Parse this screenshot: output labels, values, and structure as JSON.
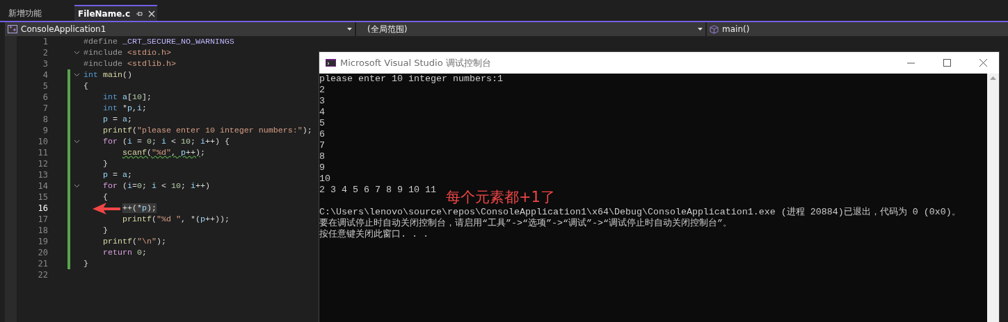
{
  "tabs": [
    {
      "label": "新增功能",
      "selected": false
    },
    {
      "label": "FileName.c",
      "selected": true
    }
  ],
  "nav_bar": {
    "project": "ConsoleApplication1",
    "scope": "(全局范围)",
    "member": "main()"
  },
  "editor": {
    "lines": [
      {
        "number": "1",
        "tokens": [
          {
            "t": "#define ",
            "kind": "pre"
          },
          {
            "t": "_CRT_SECURE_NO_WARNINGS",
            "kind": "macro"
          }
        ]
      },
      {
        "number": "2",
        "expanded": true,
        "tokens": [
          {
            "t": "#include ",
            "kind": "pre"
          },
          {
            "t": "<stdio.h>",
            "kind": "str"
          }
        ]
      },
      {
        "number": "3",
        "tokens": [
          {
            "t": "#include ",
            "kind": "pre"
          },
          {
            "t": "<stdlib.h>",
            "kind": "str"
          }
        ]
      },
      {
        "number": "4",
        "expanded": true,
        "changed": true,
        "tokens": [
          {
            "t": "int ",
            "kind": "kw"
          },
          {
            "t": "main",
            "kind": "fn"
          },
          {
            "t": "()",
            "kind": "p"
          }
        ]
      },
      {
        "number": "5",
        "changed": true,
        "tokens": [
          {
            "t": "{",
            "kind": "p"
          }
        ]
      },
      {
        "number": "6",
        "changed": true,
        "tokens": [
          {
            "t": "    int ",
            "kind": "kw"
          },
          {
            "t": "a",
            "kind": "var"
          },
          {
            "t": "[",
            "kind": "p"
          },
          {
            "t": "10",
            "kind": "num"
          },
          {
            "t": "];",
            "kind": "p"
          }
        ]
      },
      {
        "number": "7",
        "changed": true,
        "tokens": [
          {
            "t": "    int ",
            "kind": "kw"
          },
          {
            "t": "*",
            "kind": "p"
          },
          {
            "t": "p",
            "kind": "var"
          },
          {
            "t": ",",
            "kind": "p"
          },
          {
            "t": "i",
            "kind": "var"
          },
          {
            "t": ";",
            "kind": "p"
          }
        ]
      },
      {
        "number": "8",
        "changed": true,
        "tokens": [
          {
            "t": "    p",
            "kind": "var"
          },
          {
            "t": " = ",
            "kind": "p"
          },
          {
            "t": "a",
            "kind": "var"
          },
          {
            "t": ";",
            "kind": "p"
          }
        ]
      },
      {
        "number": "9",
        "changed": true,
        "tokens": [
          {
            "t": "    printf",
            "kind": "fn"
          },
          {
            "t": "(",
            "kind": "p"
          },
          {
            "t": "\"please enter 10 integer numbers:\"",
            "kind": "str"
          },
          {
            "t": ");",
            "kind": "p"
          }
        ]
      },
      {
        "number": "10",
        "expanded": true,
        "changed": true,
        "tokens": [
          {
            "t": "    for ",
            "kind": "ctl"
          },
          {
            "t": "(",
            "kind": "p"
          },
          {
            "t": "i",
            "kind": "var"
          },
          {
            "t": " = ",
            "kind": "p"
          },
          {
            "t": "0",
            "kind": "num"
          },
          {
            "t": "; ",
            "kind": "p"
          },
          {
            "t": "i",
            "kind": "var"
          },
          {
            "t": " < ",
            "kind": "p"
          },
          {
            "t": "10",
            "kind": "num"
          },
          {
            "t": "; ",
            "kind": "p"
          },
          {
            "t": "i",
            "kind": "var"
          },
          {
            "t": "++) {",
            "kind": "p"
          }
        ]
      },
      {
        "number": "11",
        "changed": true,
        "tokens": [
          {
            "t": "        scanf",
            "kind": "fn",
            "warning": true
          },
          {
            "t": "(",
            "kind": "p",
            "warning": true
          },
          {
            "t": "\"%d\"",
            "kind": "str",
            "warning": true
          },
          {
            "t": ", ",
            "kind": "p",
            "warning": true
          },
          {
            "t": "p",
            "kind": "var",
            "warning": true
          },
          {
            "t": "++)",
            "kind": "p",
            "warning": true
          },
          {
            "t": ";",
            "kind": "p"
          }
        ]
      },
      {
        "number": "12",
        "changed": true,
        "tokens": [
          {
            "t": "    }",
            "kind": "p"
          }
        ]
      },
      {
        "number": "13",
        "changed": true,
        "tokens": [
          {
            "t": "    p",
            "kind": "var"
          },
          {
            "t": " = ",
            "kind": "p"
          },
          {
            "t": "a",
            "kind": "var"
          },
          {
            "t": ";",
            "kind": "p"
          }
        ]
      },
      {
        "number": "14",
        "expanded": true,
        "changed": true,
        "tokens": [
          {
            "t": "    for ",
            "kind": "ctl"
          },
          {
            "t": "(",
            "kind": "p"
          },
          {
            "t": "i",
            "kind": "var"
          },
          {
            "t": "=",
            "kind": "p"
          },
          {
            "t": "0",
            "kind": "num"
          },
          {
            "t": "; ",
            "kind": "p"
          },
          {
            "t": "i",
            "kind": "var"
          },
          {
            "t": " < ",
            "kind": "p"
          },
          {
            "t": "10",
            "kind": "num"
          },
          {
            "t": "; ",
            "kind": "p"
          },
          {
            "t": "i",
            "kind": "var"
          },
          {
            "t": "++)",
            "kind": "p"
          }
        ]
      },
      {
        "number": "15",
        "changed": true,
        "tokens": [
          {
            "t": "    {",
            "kind": "p"
          }
        ]
      },
      {
        "number": "16",
        "changed": true,
        "current": true,
        "tokens": [
          {
            "t": "        ++(*",
            "kind": "p",
            "highlight": true
          },
          {
            "t": "p",
            "kind": "var",
            "highlight": true
          },
          {
            "t": ");",
            "kind": "p",
            "highlight": true
          }
        ]
      },
      {
        "number": "17",
        "changed": true,
        "tokens": [
          {
            "t": "        printf",
            "kind": "fn"
          },
          {
            "t": "(",
            "kind": "p"
          },
          {
            "t": "\"%d \"",
            "kind": "str"
          },
          {
            "t": ", *(",
            "kind": "p"
          },
          {
            "t": "p",
            "kind": "var"
          },
          {
            "t": "++));",
            "kind": "p"
          }
        ]
      },
      {
        "number": "18",
        "changed": true,
        "tokens": [
          {
            "t": "    }",
            "kind": "p"
          }
        ]
      },
      {
        "number": "19",
        "changed": true,
        "tokens": [
          {
            "t": "    printf",
            "kind": "fn"
          },
          {
            "t": "(",
            "kind": "p"
          },
          {
            "t": "\"\\n\"",
            "kind": "str"
          },
          {
            "t": ");",
            "kind": "p"
          }
        ]
      },
      {
        "number": "20",
        "changed": true,
        "tokens": [
          {
            "t": "    return ",
            "kind": "ctl"
          },
          {
            "t": "0",
            "kind": "num"
          },
          {
            "t": ";",
            "kind": "p"
          }
        ]
      },
      {
        "number": "21",
        "changed": true,
        "tokens": [
          {
            "t": "}",
            "kind": "p"
          }
        ]
      },
      {
        "number": "22"
      }
    ]
  },
  "console": {
    "title": "Microsoft Visual Studio 调试控制台",
    "output": [
      "please enter 10 integer numbers:1",
      "2",
      "3",
      "4",
      "5",
      "6",
      "7",
      "8",
      "9",
      "10",
      "2 3 4 5 6 7 8 9 10 11"
    ],
    "messages": [
      "C:\\Users\\lenovo\\source\\repos\\ConsoleApplication1\\x64\\Debug\\ConsoleApplication1.exe (进程 20884)已退出，代码为 0 (0x0)。",
      "要在调试停止时自动关闭控制台，请启用“工具”->“选项”->“调试”->“调试停止时自动关闭控制台”。",
      "按任意键关闭此窗口. . ."
    ]
  },
  "annotation": {
    "text": "每个元素都+1了"
  }
}
